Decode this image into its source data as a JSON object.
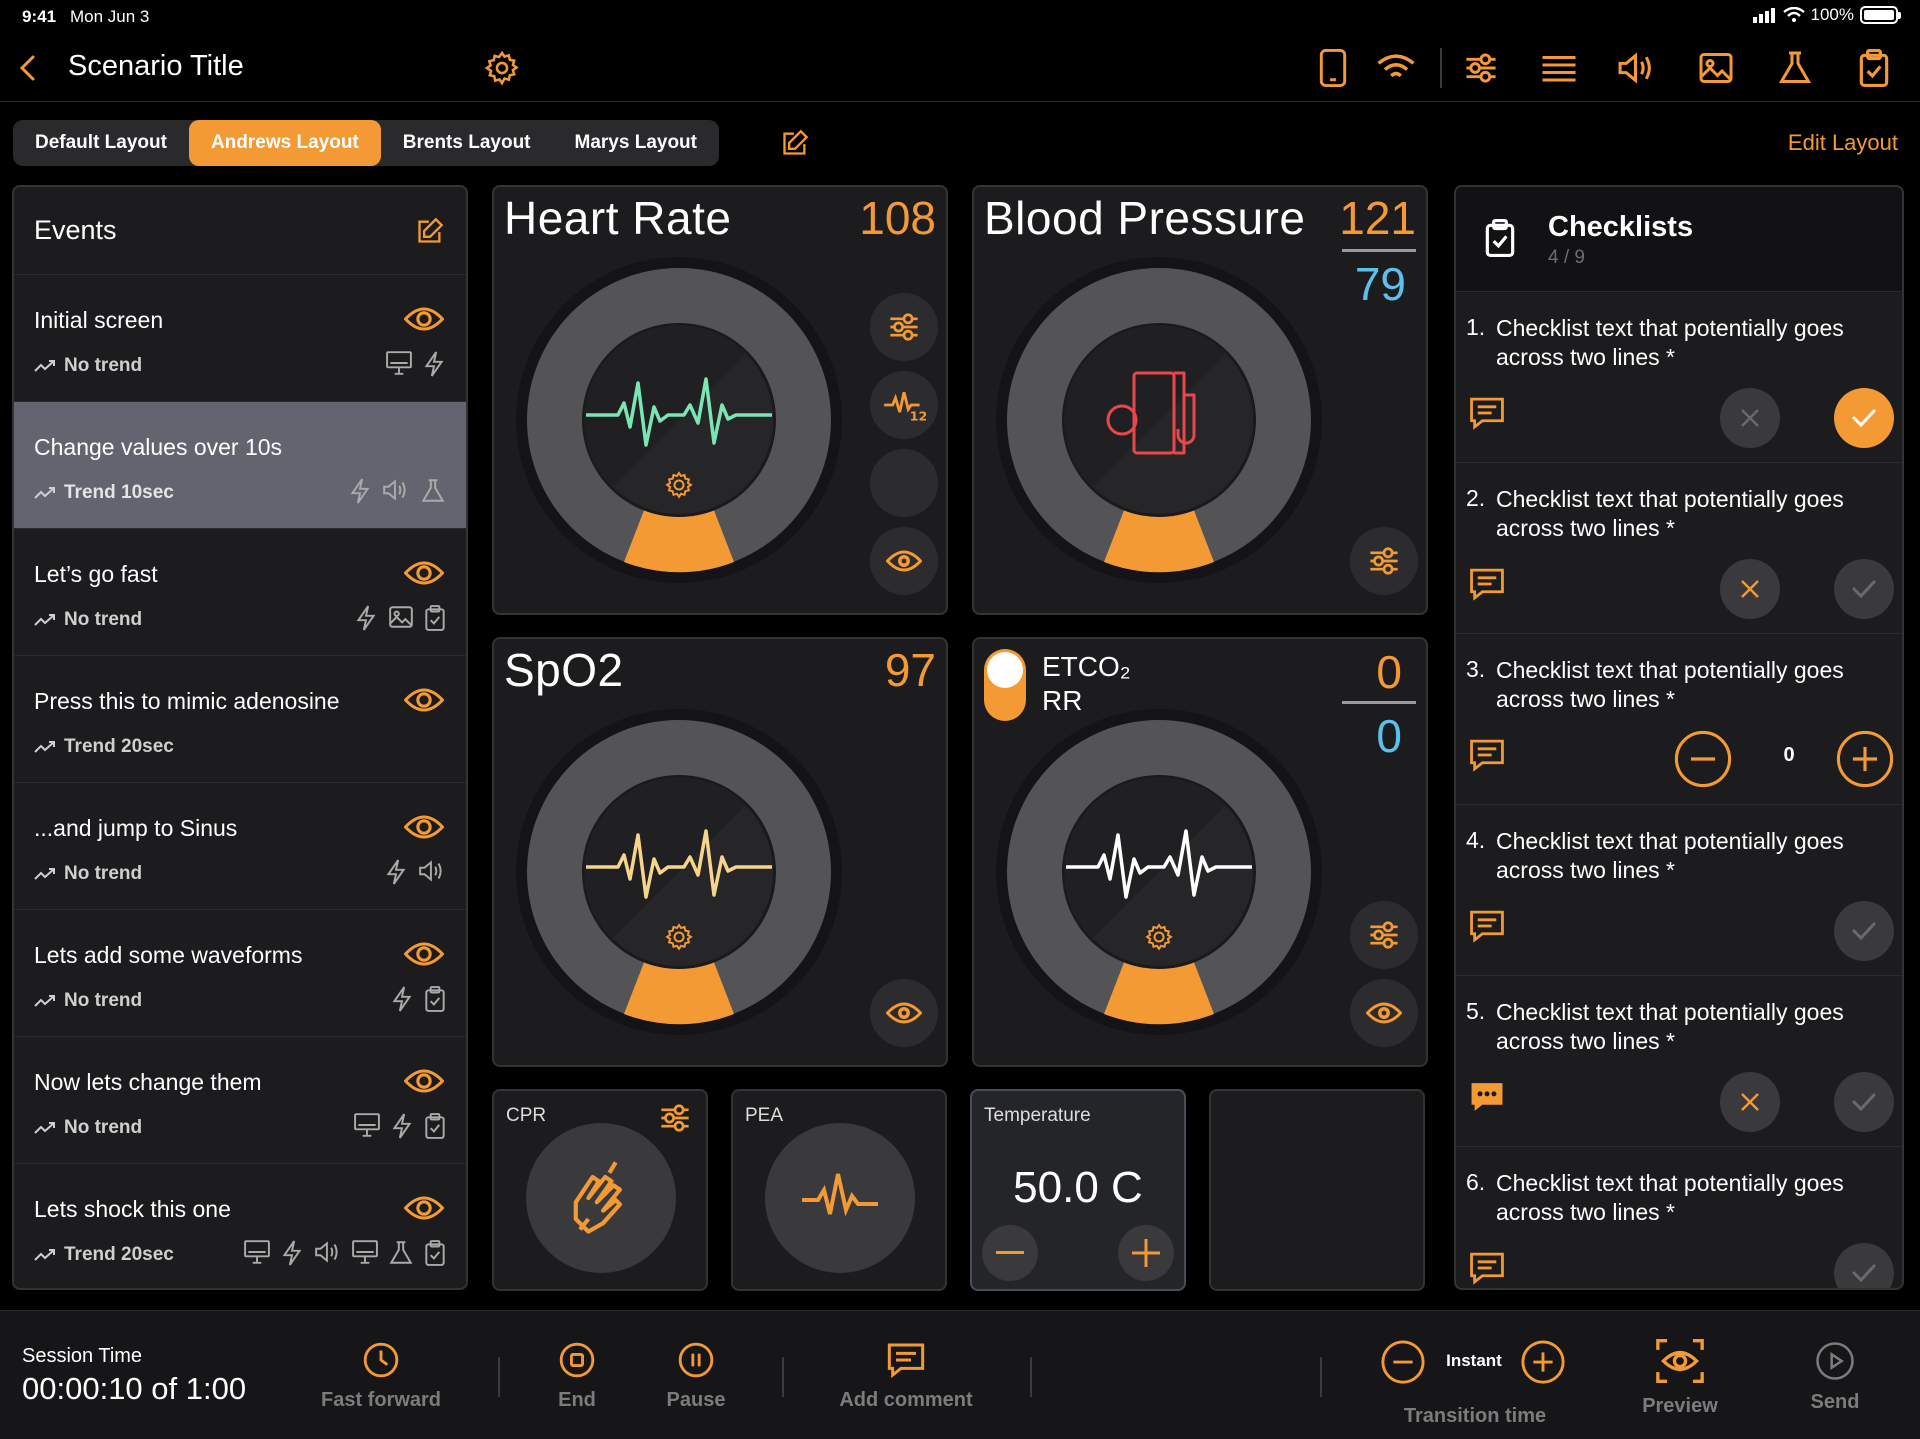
{
  "status": {
    "time": "9:41",
    "date": "Mon Jun 3",
    "battery": "100%"
  },
  "header": {
    "title": "Scenario Title"
  },
  "tabs": [
    {
      "label": "Default Layout",
      "active": false
    },
    {
      "label": "Andrews Layout",
      "active": true
    },
    {
      "label": "Brents Layout",
      "active": false
    },
    {
      "label": "Marys Layout",
      "active": false
    }
  ],
  "edit_layout": "Edit Layout",
  "events": {
    "title": "Events",
    "items": [
      {
        "name": "Initial screen",
        "trend": "No trend",
        "selected": false
      },
      {
        "name": "Change values over 10s",
        "trend": "Trend 10sec",
        "selected": true
      },
      {
        "name": "Let’s go fast",
        "trend": "No trend",
        "selected": false
      },
      {
        "name": "Press this to mimic adenosine",
        "trend": "Trend 20sec",
        "selected": false
      },
      {
        "name": "...and jump to Sinus",
        "trend": "No trend",
        "selected": false
      },
      {
        "name": "Lets add some waveforms",
        "trend": "No trend",
        "selected": false
      },
      {
        "name": "Now lets change them",
        "trend": "No trend",
        "selected": false
      },
      {
        "name": "Lets shock this one",
        "trend": "Trend 20sec",
        "selected": false
      }
    ]
  },
  "vitals": {
    "hr": {
      "name": "Heart Rate",
      "value": "108",
      "wave_color": "#7BE6B4"
    },
    "bp": {
      "name": "Blood Pressure",
      "sys": "121",
      "dia": "79"
    },
    "spo2": {
      "name": "SpO2",
      "value": "97",
      "wave_color": "#F6D58A"
    },
    "etco2": {
      "name": "ETCO₂",
      "name2": "RR",
      "value": "0",
      "value2": "0",
      "wave_color": "#ffffff"
    }
  },
  "small": {
    "cpr": "CPR",
    "pea": "PEA",
    "temperature": {
      "label": "Temperature",
      "value": "50.0 C"
    }
  },
  "checklists": {
    "title": "Checklists",
    "count": "4 / 9",
    "items": [
      {
        "num": "1.",
        "text": "Checklist text that potentially goes across two lines *"
      },
      {
        "num": "2.",
        "text": "Checklist text that potentially goes across two lines *"
      },
      {
        "num": "3.",
        "text": "Checklist text that potentially goes across two lines *",
        "counter": "0"
      },
      {
        "num": "4.",
        "text": "Checklist text that potentially goes across two lines *"
      },
      {
        "num": "5.",
        "text": "Checklist text that potentially goes across two lines *"
      },
      {
        "num": "6.",
        "text": "Checklist text that potentially goes across two lines *"
      }
    ]
  },
  "bottom": {
    "session_label": "Session Time",
    "session_value": "00:00:10 of 1:00",
    "fast_forward": "Fast forward",
    "end": "End",
    "pause": "Pause",
    "add_comment": "Add comment",
    "instant": "Instant",
    "transition_time": "Transition time",
    "preview": "Preview",
    "send": "Send"
  },
  "colors": {
    "accent": "#F39A35",
    "blue": "#5BC0EA",
    "bp_icon": "#E8474C"
  }
}
